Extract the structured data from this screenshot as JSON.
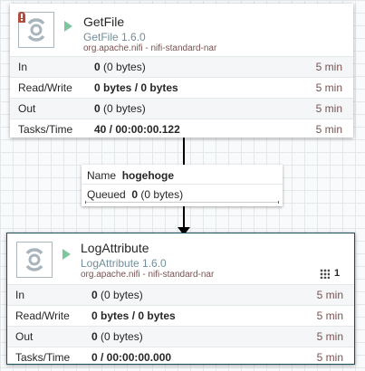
{
  "processors": [
    {
      "name": "GetFile",
      "type": "GetFile 1.6.0",
      "bundle": "org.apache.nifi - nifi-standard-nar",
      "stats": [
        {
          "label": "In",
          "value": "0",
          "detail": "(0 bytes)",
          "time": "5 min"
        },
        {
          "label": "Read/Write",
          "value": "0 bytes / 0 bytes",
          "detail": "",
          "time": "5 min"
        },
        {
          "label": "Out",
          "value": "0",
          "detail": "(0 bytes)",
          "time": "5 min"
        },
        {
          "label": "Tasks/Time",
          "value": "40 / 00:00:00.122",
          "detail": "",
          "time": "5 min"
        }
      ]
    },
    {
      "name": "LogAttribute",
      "type": "LogAttribute 1.6.0",
      "bundle": "org.apache.nifi - nifi-standard-nar",
      "task_count": "1",
      "stats": [
        {
          "label": "In",
          "value": "0",
          "detail": "(0 bytes)",
          "time": "5 min"
        },
        {
          "label": "Read/Write",
          "value": "0 bytes / 0 bytes",
          "detail": "",
          "time": "5 min"
        },
        {
          "label": "Out",
          "value": "0",
          "detail": "(0 bytes)",
          "time": "5 min"
        },
        {
          "label": "Tasks/Time",
          "value": "0 / 00:00:00.000",
          "detail": "",
          "time": "5 min"
        }
      ]
    }
  ],
  "connection": {
    "name_label": "Name",
    "name": "hogehoge",
    "queued_label": "Queued",
    "queued_value": "0",
    "queued_detail": "(0 bytes)"
  },
  "icons": {
    "processor": "processor-icon",
    "running": "play-icon",
    "warning": "warning-icon",
    "tasks": "cluster-icon"
  },
  "colors": {
    "accent": "#728e9b",
    "running": "#7dc7a0",
    "selected_border": "#1c4d5e",
    "warning": "#b54b3c"
  }
}
